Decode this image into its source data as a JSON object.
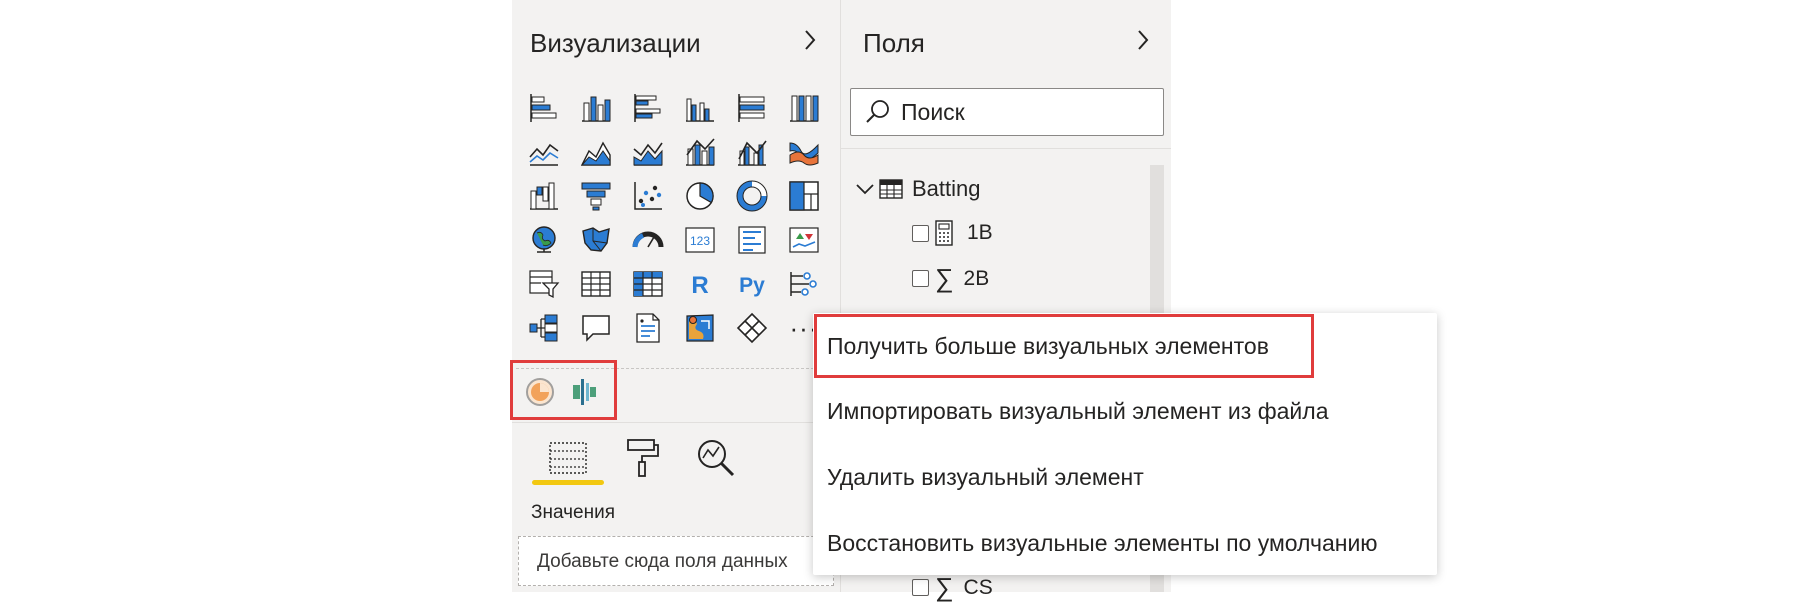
{
  "visualizations": {
    "title": "Визуализации",
    "values_label": "Значения",
    "values_placeholder": "Добавьте сюда поля данных",
    "more_label": "···",
    "r_label": "R",
    "py_label": "Py",
    "card_number": "123"
  },
  "fields": {
    "title": "Поля",
    "search_placeholder": "Поиск",
    "table": {
      "name": "Batting",
      "fields": [
        {
          "name": "1B",
          "icon": "calculator-icon"
        },
        {
          "name": "2B",
          "icon": "sigma-icon"
        },
        {
          "name": "CS",
          "icon": "sigma-icon"
        }
      ]
    }
  },
  "context_menu": {
    "items": [
      "Получить больше визуальных элементов",
      "Импортировать визуальный элемент из файла",
      "Удалить визуальный элемент",
      "Восстановить визуальные элементы по умолчанию"
    ]
  },
  "colors": {
    "accent_blue": "#2b7cd3",
    "highlight_red": "#e03c3c",
    "tab_underline": "#f2c811",
    "pane_bg": "#f3f2f1"
  }
}
